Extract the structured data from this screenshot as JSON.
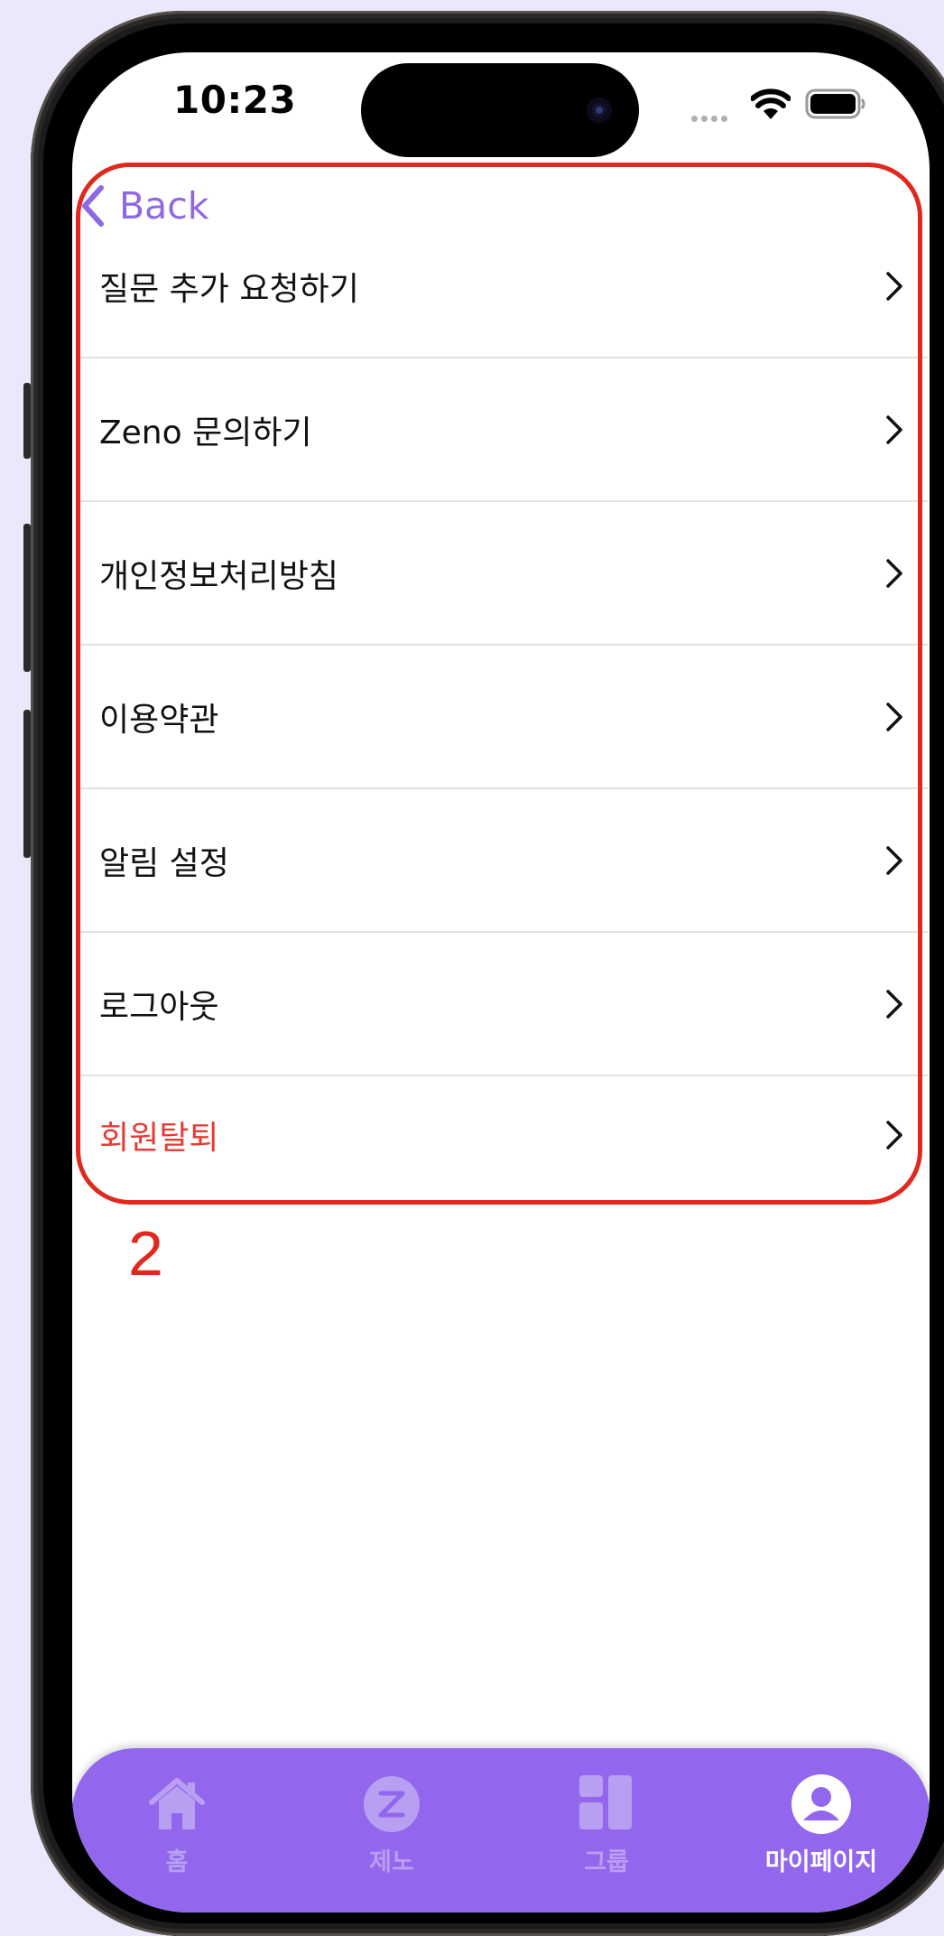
{
  "status_bar": {
    "time": "10:23"
  },
  "nav": {
    "back_label": "Back"
  },
  "menu": {
    "items": [
      {
        "label": "질문 추가 요청하기"
      },
      {
        "label": "Zeno 문의하기"
      },
      {
        "label": "개인정보처리방침"
      },
      {
        "label": "이용약관"
      },
      {
        "label": "알림 설정"
      },
      {
        "label": "로그아웃"
      },
      {
        "label": "회원탈퇴",
        "style": "danger"
      }
    ]
  },
  "annotation": {
    "number": "2",
    "color": "#e0281e"
  },
  "tabbar": {
    "background": "#9366ee",
    "tabs": [
      {
        "label": "홈",
        "icon": "home-icon",
        "active": false
      },
      {
        "label": "제노",
        "icon": "zeno-icon",
        "active": false
      },
      {
        "label": "그룹",
        "icon": "group-icon",
        "active": false
      },
      {
        "label": "마이페이지",
        "icon": "profile-icon",
        "active": true
      }
    ]
  },
  "colors": {
    "accent": "#8f68e4",
    "danger": "#e73b32"
  }
}
